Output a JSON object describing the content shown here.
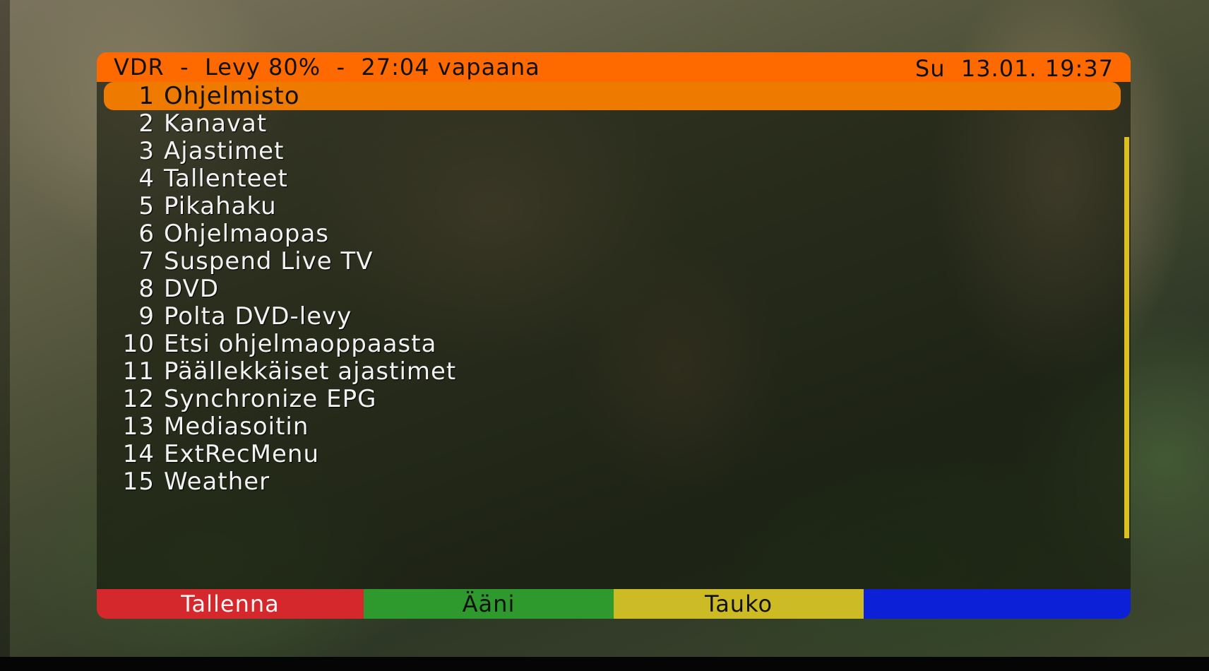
{
  "header": {
    "status": "VDR  -  Levy 80%  -  27:04 vapaana",
    "datetime": "Su  13.01. 19:37"
  },
  "menu": {
    "selected_index": 0,
    "items": [
      {
        "num": "1",
        "label": "Ohjelmisto"
      },
      {
        "num": "2",
        "label": "Kanavat"
      },
      {
        "num": "3",
        "label": "Ajastimet"
      },
      {
        "num": "4",
        "label": "Tallenteet"
      },
      {
        "num": "5",
        "label": "Pikahaku"
      },
      {
        "num": "6",
        "label": "Ohjelmaopas"
      },
      {
        "num": "7",
        "label": "Suspend Live TV"
      },
      {
        "num": "8",
        "label": "DVD"
      },
      {
        "num": "9",
        "label": "Polta DVD-levy"
      },
      {
        "num": "10",
        "label": "Etsi ohjelmaoppaasta"
      },
      {
        "num": "11",
        "label": "Päällekkäiset ajastimet"
      },
      {
        "num": "12",
        "label": "Synchronize EPG"
      },
      {
        "num": "13",
        "label": "Mediasoitin"
      },
      {
        "num": "14",
        "label": "ExtRecMenu"
      },
      {
        "num": "15",
        "label": "Weather"
      }
    ]
  },
  "footer": {
    "red": "Tallenna",
    "green": "Ääni",
    "yellow": "Tauko",
    "blue": ""
  },
  "colors": {
    "header": "#ff6a00",
    "selection": "#ee7a00",
    "red": "#d4282c",
    "green": "#2e9a2e",
    "yellow": "#cdbb26",
    "blue": "#0c20d8"
  }
}
